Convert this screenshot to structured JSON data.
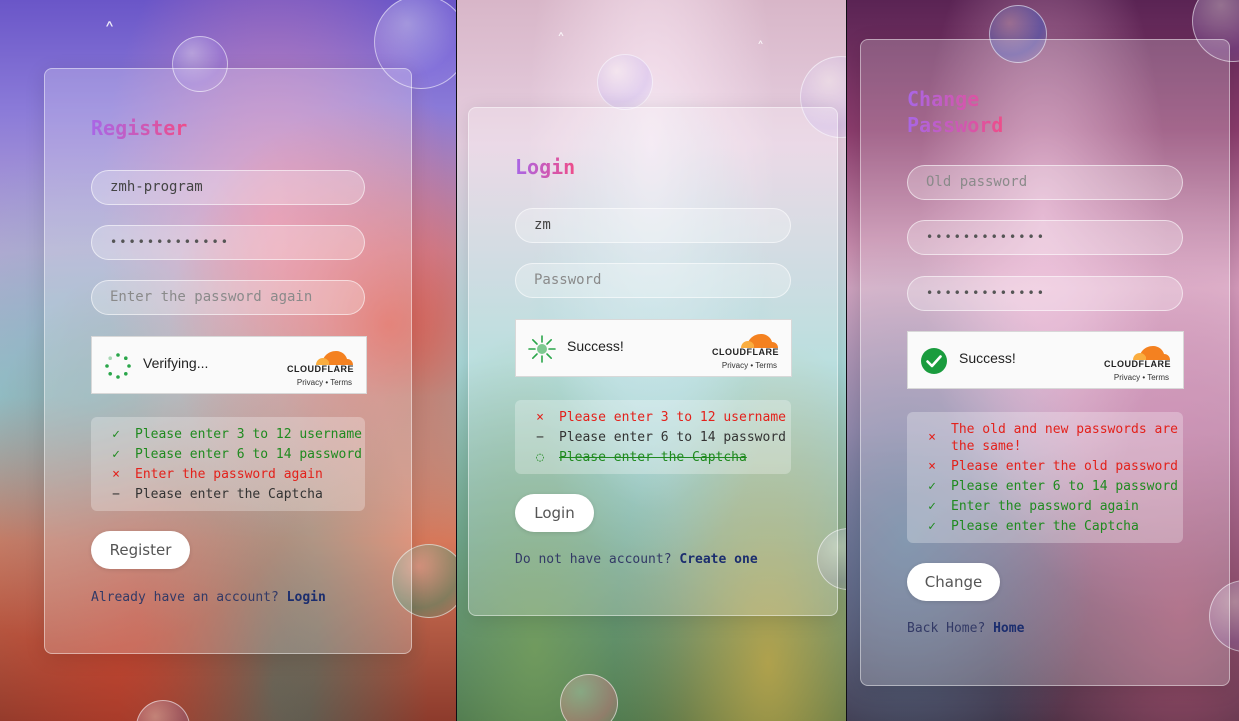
{
  "register": {
    "title": "Register",
    "username_value": "zmh-program",
    "password_value": "•••••••••••••",
    "confirm_placeholder": "Enter the password again",
    "captcha_status": "Verifying...",
    "captcha_brand": "CLOUDFLARE",
    "captcha_links": "Privacy • Terms",
    "rules": [
      {
        "mark": "✓",
        "state": "ok",
        "text": "Please enter 3 to 12 username"
      },
      {
        "mark": "✓",
        "state": "ok",
        "text": "Please enter 6 to 14 password"
      },
      {
        "mark": "×",
        "state": "bad",
        "text": "Enter the password again"
      },
      {
        "mark": "−",
        "state": "neutral",
        "text": "Please enter the Captcha"
      }
    ],
    "button_label": "Register",
    "footer_text": "Already have an account?",
    "footer_link": "Login"
  },
  "login": {
    "title": "Login",
    "username_value": "zm",
    "password_placeholder": "Password",
    "captcha_status": "Success!",
    "captcha_brand": "CLOUDFLARE",
    "captcha_links": "Privacy • Terms",
    "rules": [
      {
        "mark": "×",
        "state": "bad",
        "text": "Please enter 3 to 12 username"
      },
      {
        "mark": "−",
        "state": "neutral",
        "text": "Please enter 6 to 14 password"
      },
      {
        "mark": "◌",
        "state": "ok",
        "text": "Please enter the Captcha"
      }
    ],
    "button_label": "Login",
    "footer_text": "Do not have account?",
    "footer_link": "Create one"
  },
  "change": {
    "title_line1": "Change",
    "title_line2": "Password",
    "old_placeholder": "Old password",
    "new_value": "•••••••••••••",
    "confirm_value": "•••••••••••••",
    "captcha_status": "Success!",
    "captcha_brand": "CLOUDFLARE",
    "captcha_links": "Privacy • Terms",
    "rules": [
      {
        "mark": "×",
        "state": "bad",
        "text": "The old and new passwords are\nthe same!"
      },
      {
        "mark": "×",
        "state": "bad",
        "text": "Please enter the old password"
      },
      {
        "mark": "✓",
        "state": "ok",
        "text": "Please enter 6 to 14 password"
      },
      {
        "mark": "✓",
        "state": "ok",
        "text": "Enter the password again"
      },
      {
        "mark": "✓",
        "state": "ok",
        "text": "Please enter the Captcha"
      }
    ],
    "button_label": "Change",
    "footer_text": "Back Home?",
    "footer_link": "Home"
  },
  "colors": {
    "ok": "#1f8a1f",
    "bad": "#e3211b",
    "title_start": "#a866e6",
    "title_end": "#ee4d8a",
    "cloudflare_orange": "#f48120",
    "success_green": "#1a9c3e"
  }
}
